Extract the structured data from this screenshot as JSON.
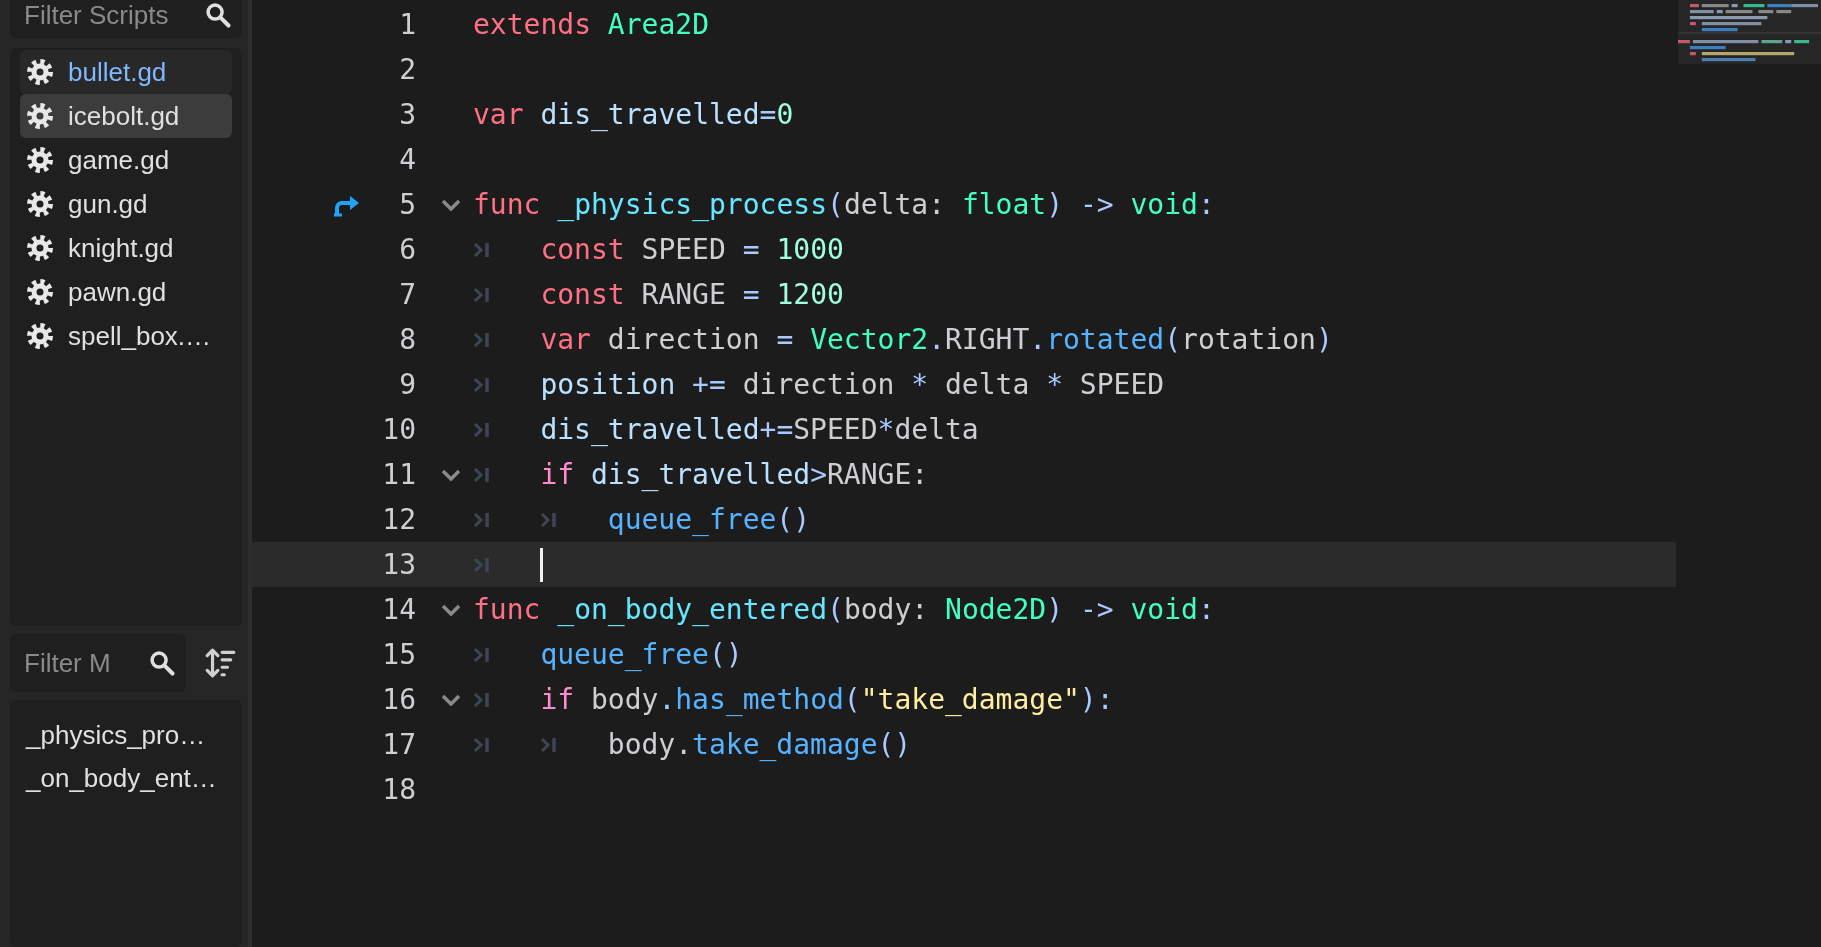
{
  "scripts_filter": {
    "placeholder": "Filter Scripts"
  },
  "scripts": [
    {
      "name": "bullet.gd",
      "current": true,
      "selected": false
    },
    {
      "name": "icebolt.gd",
      "current": false,
      "selected": true
    },
    {
      "name": "game.gd",
      "current": false,
      "selected": false
    },
    {
      "name": "gun.gd",
      "current": false,
      "selected": false
    },
    {
      "name": "knight.gd",
      "current": false,
      "selected": false
    },
    {
      "name": "pawn.gd",
      "current": false,
      "selected": false
    },
    {
      "name": "spell_box.…",
      "current": false,
      "selected": false
    }
  ],
  "methods_filter": {
    "placeholder": "Filter M"
  },
  "methods": [
    "_physics_pro…",
    "_on_body_ent…"
  ],
  "code_lines": [
    {
      "number": "1",
      "foldable": false,
      "current": false,
      "override_marker": false,
      "tokens": [
        {
          "text": "extends ",
          "kind": "keyword"
        },
        {
          "text": "Area2D",
          "kind": "type"
        }
      ]
    },
    {
      "number": "2",
      "foldable": false,
      "current": false,
      "override_marker": false
    },
    {
      "number": "3",
      "foldable": false,
      "current": false,
      "override_marker": false,
      "tokens": [
        {
          "text": "var ",
          "kind": "keyword"
        },
        {
          "text": "dis_travelled",
          "kind": "member"
        },
        {
          "text": "=",
          "kind": "symbol"
        },
        {
          "text": "0",
          "kind": "number"
        }
      ]
    },
    {
      "number": "4",
      "foldable": false,
      "current": false,
      "override_marker": false
    },
    {
      "number": "5",
      "foldable": true,
      "current": false,
      "override_marker": true,
      "tokens": [
        {
          "text": "func ",
          "kind": "keyword"
        },
        {
          "text": "_physics_process",
          "kind": "declaration"
        },
        {
          "text": "(",
          "kind": "symbol"
        },
        {
          "text": "delta: ",
          "kind": "plain"
        },
        {
          "text": "float",
          "kind": "type"
        },
        {
          "text": ") -> ",
          "kind": "symbol"
        },
        {
          "text": "void",
          "kind": "type"
        },
        {
          "text": ":",
          "kind": "symbol"
        }
      ]
    },
    {
      "number": "6",
      "foldable": false,
      "current": false,
      "override_marker": false,
      "tokens": [
        {
          "kind": "tab"
        },
        {
          "text": "const ",
          "kind": "keyword"
        },
        {
          "text": "SPEED ",
          "kind": "plain"
        },
        {
          "text": "= ",
          "kind": "symbol"
        },
        {
          "text": "1000",
          "kind": "number"
        }
      ]
    },
    {
      "number": "7",
      "foldable": false,
      "current": false,
      "override_marker": false,
      "tokens": [
        {
          "kind": "tab"
        },
        {
          "text": "const ",
          "kind": "keyword"
        },
        {
          "text": "RANGE ",
          "kind": "plain"
        },
        {
          "text": "= ",
          "kind": "symbol"
        },
        {
          "text": "1200",
          "kind": "number"
        }
      ]
    },
    {
      "number": "8",
      "foldable": false,
      "current": false,
      "override_marker": false,
      "tokens": [
        {
          "kind": "tab"
        },
        {
          "text": "var ",
          "kind": "keyword"
        },
        {
          "text": "direction ",
          "kind": "plain"
        },
        {
          "text": "= ",
          "kind": "symbol"
        },
        {
          "text": "Vector2",
          "kind": "type"
        },
        {
          "text": ".",
          "kind": "symbol"
        },
        {
          "text": "RIGHT",
          "kind": "plain"
        },
        {
          "text": ".",
          "kind": "symbol"
        },
        {
          "text": "rotated",
          "kind": "function"
        },
        {
          "text": "(",
          "kind": "symbol"
        },
        {
          "text": "rotation",
          "kind": "plain"
        },
        {
          "text": ")",
          "kind": "symbol"
        }
      ]
    },
    {
      "number": "9",
      "foldable": false,
      "current": false,
      "override_marker": false,
      "tokens": [
        {
          "kind": "tab"
        },
        {
          "text": "position ",
          "kind": "member"
        },
        {
          "text": "+= ",
          "kind": "symbol"
        },
        {
          "text": "direction ",
          "kind": "plain"
        },
        {
          "text": "* ",
          "kind": "symbol"
        },
        {
          "text": "delta ",
          "kind": "plain"
        },
        {
          "text": "* ",
          "kind": "symbol"
        },
        {
          "text": "SPEED",
          "kind": "plain"
        }
      ]
    },
    {
      "number": "10",
      "foldable": false,
      "current": false,
      "override_marker": false,
      "tokens": [
        {
          "kind": "tab"
        },
        {
          "text": "dis_travelled",
          "kind": "member"
        },
        {
          "text": "+=",
          "kind": "symbol"
        },
        {
          "text": "SPEED",
          "kind": "plain"
        },
        {
          "text": "*",
          "kind": "symbol"
        },
        {
          "text": "delta",
          "kind": "plain"
        }
      ]
    },
    {
      "number": "11",
      "foldable": true,
      "current": false,
      "override_marker": false,
      "tokens": [
        {
          "kind": "tab"
        },
        {
          "text": "if ",
          "kind": "control"
        },
        {
          "text": "dis_travelled",
          "kind": "member"
        },
        {
          "text": ">",
          "kind": "symbol"
        },
        {
          "text": "RANGE:",
          "kind": "plain"
        }
      ]
    },
    {
      "number": "12",
      "foldable": false,
      "current": false,
      "override_marker": false,
      "tokens": [
        {
          "kind": "tab"
        },
        {
          "kind": "tab"
        },
        {
          "text": "queue_free",
          "kind": "function"
        },
        {
          "text": "()",
          "kind": "symbol"
        }
      ]
    },
    {
      "number": "13",
      "foldable": false,
      "current": true,
      "override_marker": false,
      "tokens": [
        {
          "kind": "tab"
        }
      ]
    },
    {
      "number": "14",
      "foldable": true,
      "current": false,
      "override_marker": false,
      "tokens": [
        {
          "text": "func ",
          "kind": "keyword"
        },
        {
          "text": "_on_body_entered",
          "kind": "declaration"
        },
        {
          "text": "(",
          "kind": "symbol"
        },
        {
          "text": "body: ",
          "kind": "plain"
        },
        {
          "text": "Node2D",
          "kind": "type"
        },
        {
          "text": ") -> ",
          "kind": "symbol"
        },
        {
          "text": "void",
          "kind": "type"
        },
        {
          "text": ":",
          "kind": "symbol"
        }
      ]
    },
    {
      "number": "15",
      "foldable": false,
      "current": false,
      "override_marker": false,
      "tokens": [
        {
          "kind": "tab"
        },
        {
          "text": "queue_free",
          "kind": "function"
        },
        {
          "text": "()",
          "kind": "symbol"
        }
      ]
    },
    {
      "number": "16",
      "foldable": true,
      "current": false,
      "override_marker": false,
      "tokens": [
        {
          "kind": "tab"
        },
        {
          "text": "if ",
          "kind": "control"
        },
        {
          "text": "body",
          "kind": "plain"
        },
        {
          "text": ".",
          "kind": "symbol"
        },
        {
          "text": "has_method",
          "kind": "function"
        },
        {
          "text": "(",
          "kind": "symbol"
        },
        {
          "text": "\"take_damage\"",
          "kind": "string"
        },
        {
          "text": "):",
          "kind": "symbol"
        }
      ]
    },
    {
      "number": "17",
      "foldable": false,
      "current": false,
      "override_marker": false,
      "tokens": [
        {
          "kind": "tab"
        },
        {
          "kind": "tab"
        },
        {
          "text": "body.",
          "kind": "plain"
        },
        {
          "text": "take_damage",
          "kind": "function"
        },
        {
          "text": "()",
          "kind": "symbol"
        }
      ]
    },
    {
      "number": "18",
      "foldable": false,
      "current": false,
      "override_marker": false
    }
  ]
}
